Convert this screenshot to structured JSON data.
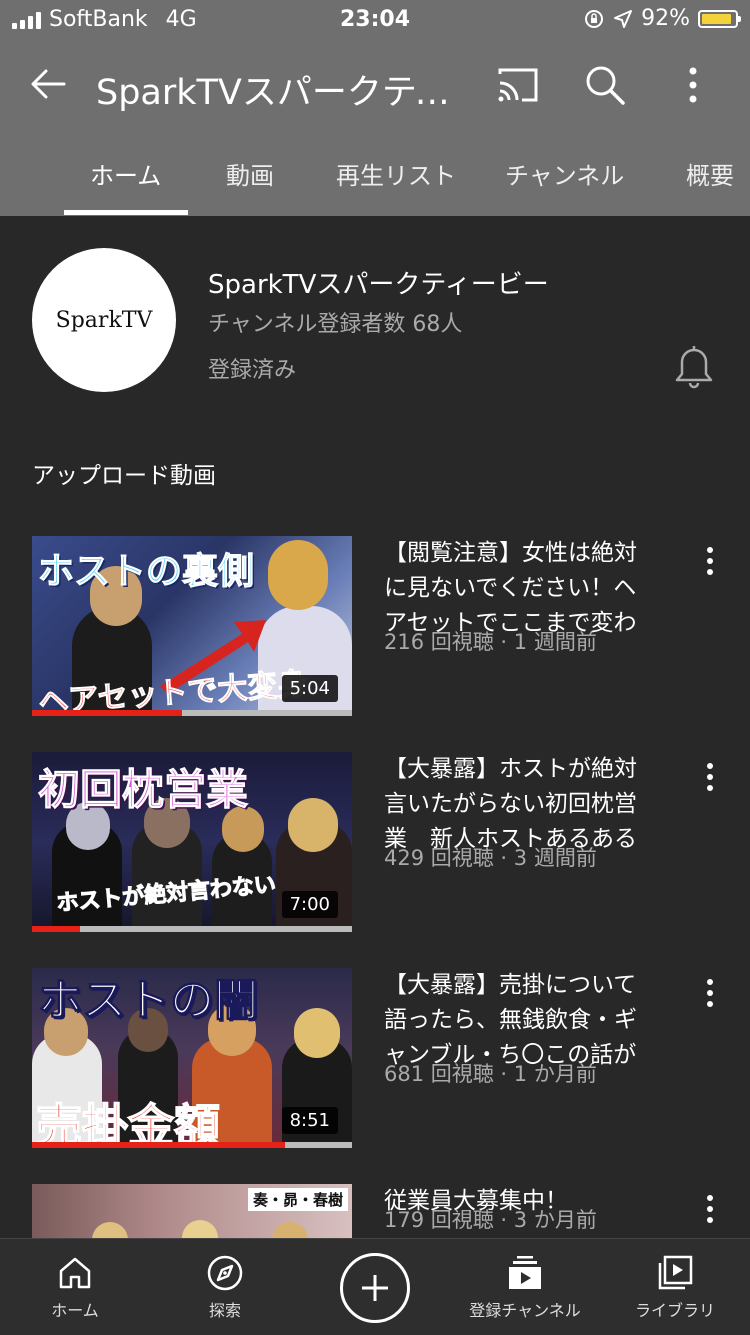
{
  "status_bar": {
    "carrier": "SoftBank",
    "network": "4G",
    "time": "23:04",
    "battery_percent": "92%",
    "battery_level": 0.92
  },
  "app_bar": {
    "title": "SparkTVスパークティービー",
    "icons": [
      "back-arrow-icon",
      "cast-icon",
      "search-icon",
      "more-vert-icon"
    ]
  },
  "tabs": [
    {
      "label": "ホーム",
      "active": true
    },
    {
      "label": "動画"
    },
    {
      "label": "再生リスト"
    },
    {
      "label": "チャンネル"
    },
    {
      "label": "概要"
    }
  ],
  "channel": {
    "avatar_text": "SparkTV",
    "name": "SparkTVスパークティービー",
    "subscribers": "チャンネル登録者数 68人",
    "status": "登録済み"
  },
  "section_title": "アップロード動画",
  "videos": [
    {
      "title": "【閲覧注意】女性は絶対に見ないでください！ヘアセットでここまで変わる",
      "meta": "216 回視聴 · 1 週間前",
      "duration": "5:04",
      "watched_fraction": 0.47,
      "thumb_caption_top": "ホストの裏側",
      "thumb_caption_bottom": "ヘアセットで大変身"
    },
    {
      "title": "【大暴露】ホストが絶対言いたがらない初回枕営業　新人ホストあるある",
      "meta": "429 回視聴 · 3 週間前",
      "duration": "7:00",
      "watched_fraction": 0.15,
      "thumb_caption_top": "初回枕営業",
      "thumb_caption_bottom": "ホストが絶対言わない"
    },
    {
      "title": "【大暴露】売掛について語ったら、無銭飲食・ギャンブル・ち〇この話が",
      "meta": "681 回視聴 · 1 か月前",
      "duration": "8:51",
      "watched_fraction": 0.79,
      "thumb_caption_top": "ホストの闇",
      "thumb_caption_bottom": "売掛金額"
    },
    {
      "title": "従業員大募集中！",
      "meta": "179 回視聴 · 3 か月前",
      "thumb_caption_top": "奏・昴・春樹"
    }
  ],
  "bottom_nav": [
    {
      "label": "ホーム",
      "icon": "home-icon"
    },
    {
      "label": "探索",
      "icon": "compass-icon"
    },
    {
      "label": "",
      "icon": "create-plus-icon"
    },
    {
      "label": "登録チャンネル",
      "icon": "subscriptions-icon"
    },
    {
      "label": "ライブラリ",
      "icon": "library-icon"
    }
  ]
}
